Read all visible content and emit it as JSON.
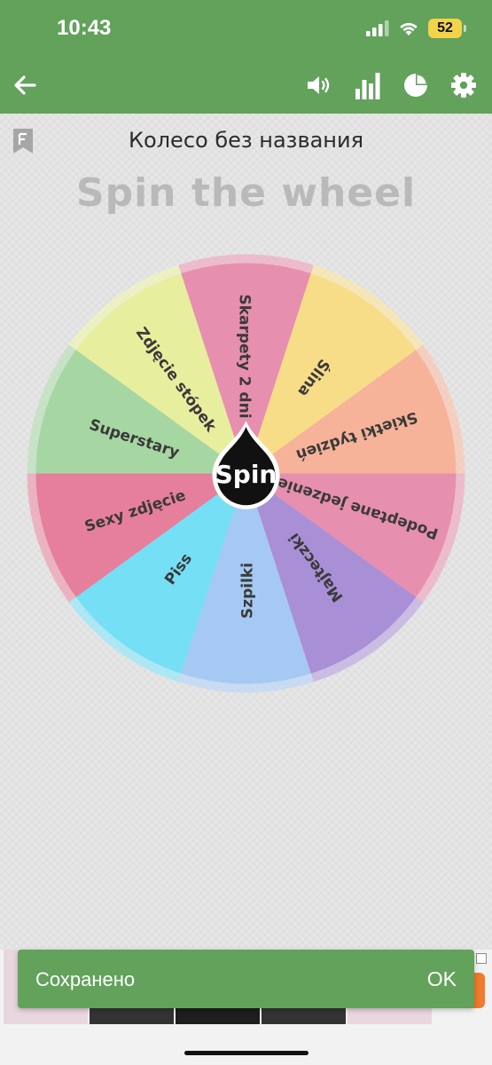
{
  "status_bar": {
    "time": "10:43",
    "battery": "52",
    "icons": [
      "cellular-signal-icon",
      "wifi-icon",
      "battery-icon"
    ]
  },
  "app_bar": {
    "icons": [
      "back-arrow-icon",
      "volume-icon",
      "bar-chart-icon",
      "pie-chart-icon",
      "gear-icon"
    ],
    "color": "#62a25b"
  },
  "wheel": {
    "name": "Колесо без названия",
    "title": "Spin the wheel",
    "center_label": "Spin",
    "segments": [
      {
        "label": "Szpilki",
        "color": "#e78fae"
      },
      {
        "label": "Piss",
        "color": "#f8dd88"
      },
      {
        "label": "Sexy zdjęcie",
        "color": "#f6b399"
      },
      {
        "label": "Superstary",
        "color": "#e78fae"
      },
      {
        "label": "Zdjęcie stópek",
        "color": "#a98fd6"
      },
      {
        "label": "Skarpety 2 dni",
        "color": "#a6c9f3"
      },
      {
        "label": "Ślina",
        "color": "#75dff5"
      },
      {
        "label": "Skietki tydzień",
        "color": "#e67f9b"
      },
      {
        "label": "Podeptane jedzenie",
        "color": "#a6d6a2"
      },
      {
        "label": "Majteczki",
        "color": "#e7ee9e"
      }
    ]
  },
  "snackbar": {
    "message": "Сохранено",
    "action": "OK"
  }
}
